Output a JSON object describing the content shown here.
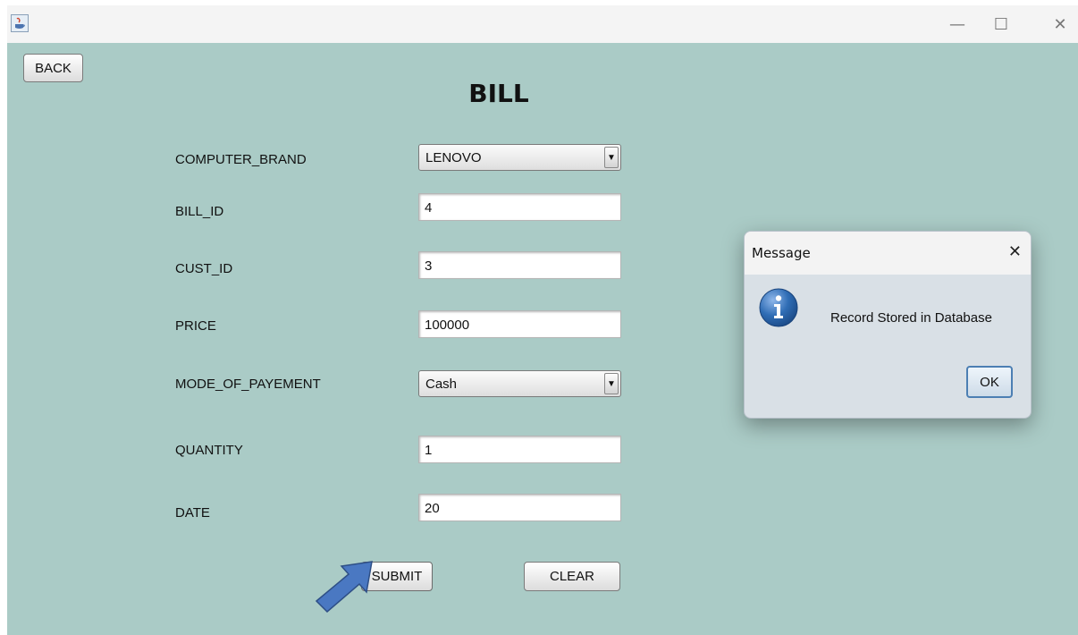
{
  "window": {
    "icon": "java-icon",
    "controls": {
      "minimize": "—",
      "maximize": "☐",
      "close": "✕"
    }
  },
  "form": {
    "back_label": "BACK",
    "title": "BILL",
    "fields": {
      "computer_brand": {
        "label": "COMPUTER_BRAND",
        "value": "LENOVO"
      },
      "bill_id": {
        "label": "BILL_ID",
        "value": "4"
      },
      "cust_id": {
        "label": "CUST_ID",
        "value": "3"
      },
      "price": {
        "label": "PRICE",
        "value": "100000"
      },
      "mode_of_payment": {
        "label": "MODE_OF_PAYEMENT",
        "value": "Cash"
      },
      "quantity": {
        "label": "QUANTITY",
        "value": "1"
      },
      "date": {
        "label": "DATE",
        "value": "20"
      }
    },
    "combo_arrow": "▼",
    "submit_label": "SUBMIT",
    "clear_label": "CLEAR"
  },
  "dialog": {
    "title": "Message",
    "close": "✕",
    "icon": "info-icon",
    "message": "Record Stored in Database",
    "ok_label": "OK"
  },
  "colors": {
    "background": "#aacbc6",
    "arrow": "#4a78c2",
    "info_icon": "#2f6db5"
  }
}
